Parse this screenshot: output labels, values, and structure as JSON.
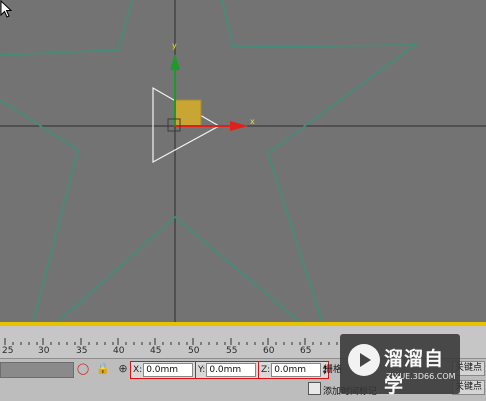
{
  "ruler": {
    "ticks": [
      "25",
      "30",
      "35",
      "40",
      "45",
      "50",
      "55",
      "60",
      "65"
    ]
  },
  "coordinates": {
    "x_label": "X:",
    "x_value": "0.0mm",
    "y_label": "Y:",
    "y_value": "0.0mm",
    "z_label": "Z:",
    "z_value": "0.0mm"
  },
  "status": {
    "grid_label": "栅格",
    "add_time_label": "添加时间标记",
    "key_button_top": "关键点",
    "key_button_bottom": "关键点"
  },
  "gizmo": {
    "axis_y": "y",
    "axis_x": "x"
  },
  "watermark": {
    "title": "溜溜自学",
    "url": "ZIXUE.3D66.COM"
  },
  "colors": {
    "viewport_bg": "#737373",
    "star_spline": "#3f8f7a",
    "gizmo_yellow": "#c9a634",
    "x_axis": "#e0201a",
    "y_axis": "#1d9a2a",
    "highlight_red": "#dd1111",
    "timeline_yellow": "#e8c100"
  },
  "icons": [
    "bulb-icon",
    "lock-icon",
    "transform-mode-icon",
    "select-box-icon",
    "mouse-cursor-icon"
  ]
}
